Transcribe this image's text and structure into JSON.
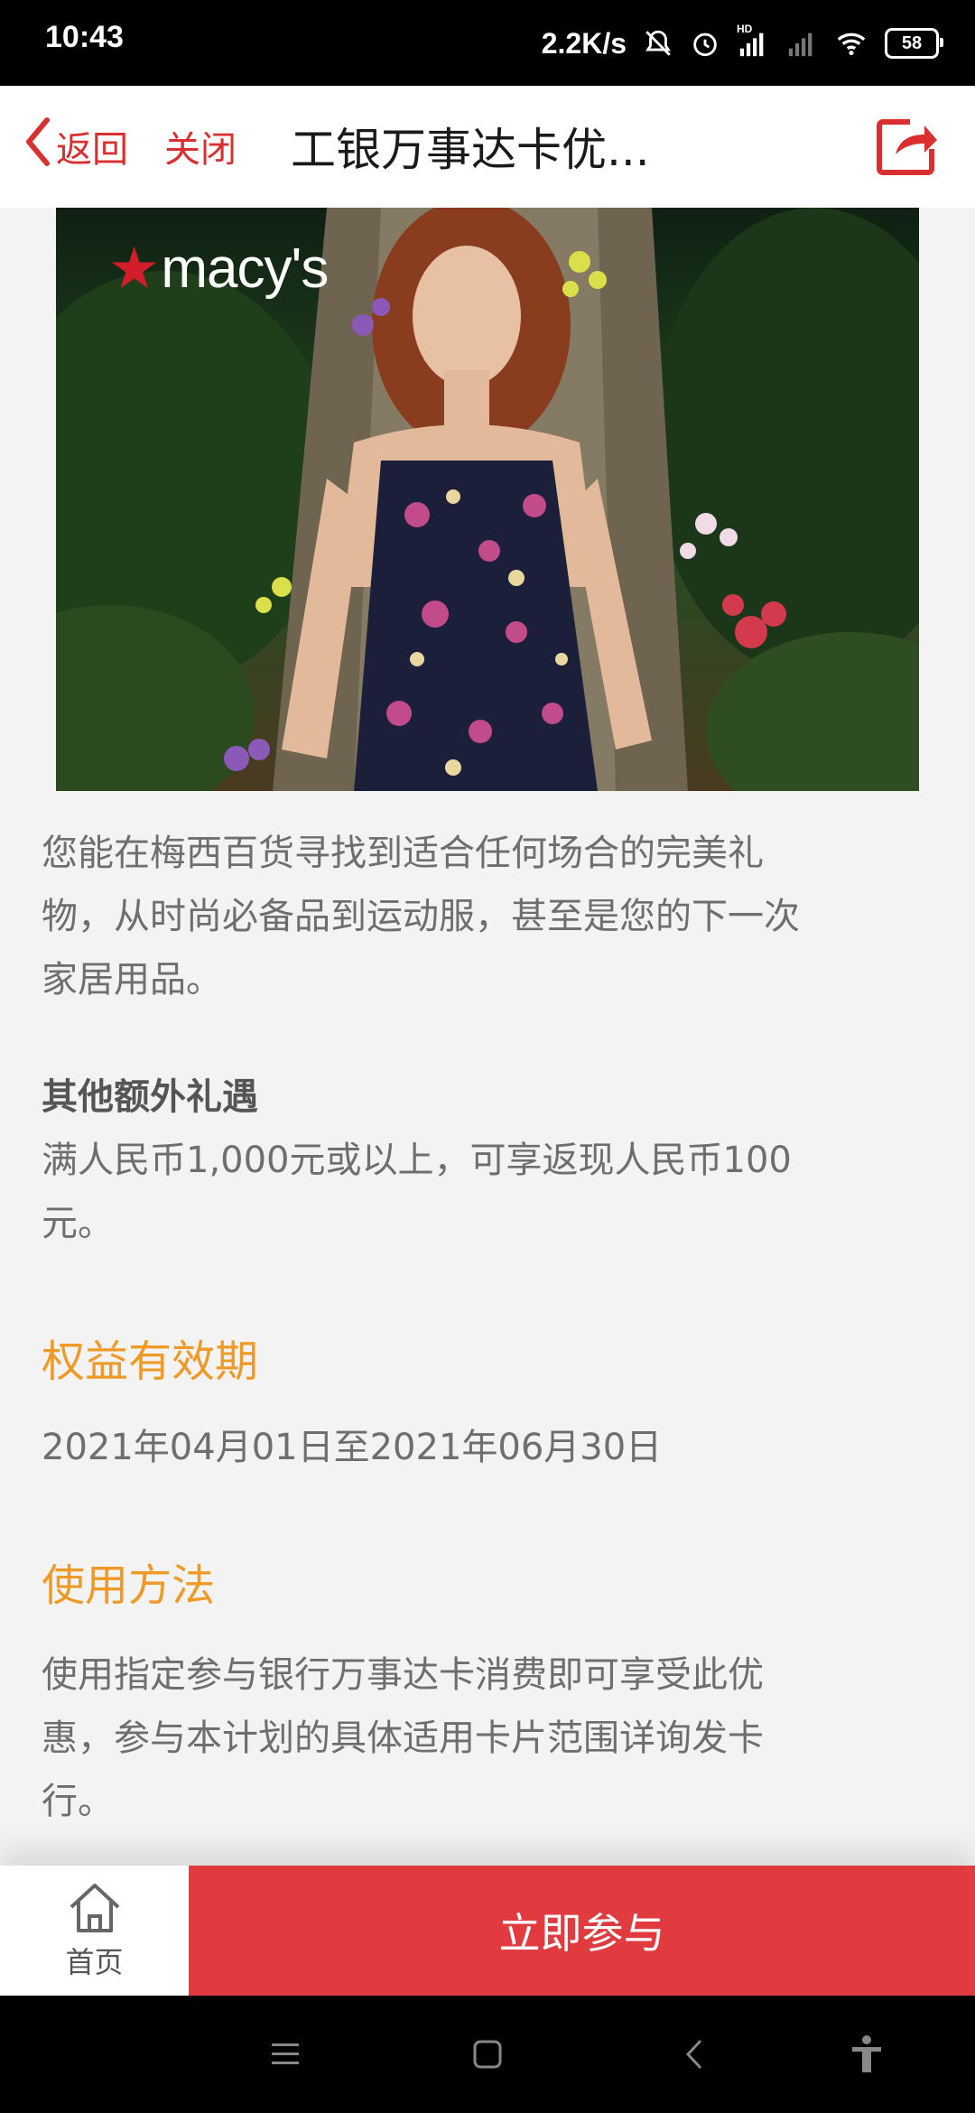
{
  "status_bar": {
    "time": "10:43",
    "network_speed": "2.2K/s",
    "battery": "58",
    "hd_label": "HD"
  },
  "header": {
    "back_label": "返回",
    "close_label": "关闭",
    "title": "工银万事达卡优..."
  },
  "hero": {
    "brand_logo": "macy's"
  },
  "content": {
    "intro_lines": [
      "您能在梅西百货寻找到适合任何场合的完美礼",
      "物，从时尚必备品到运动服，甚至是您的下一次",
      "家居用品。"
    ],
    "extra_heading": "其他额外礼遇",
    "extra_lines": [
      "满人民币1,000元或以上，可享返现人民币100",
      "元。"
    ],
    "validity_heading": "权益有效期",
    "validity_text": "2021年04月01日至2021年06月30日",
    "usage_heading": "使用方法",
    "usage_lines": [
      "使用指定参与银行万事达卡消费即可享受此优",
      "惠，参与本计划的具体适用卡片范围详询发卡",
      "行。"
    ]
  },
  "bottom_bar": {
    "home_label": "首页",
    "join_label": "立即参与"
  },
  "colors": {
    "accent_red": "#e13a3f",
    "heading_orange": "#ef9a27",
    "body_text": "#6e6e6e"
  }
}
